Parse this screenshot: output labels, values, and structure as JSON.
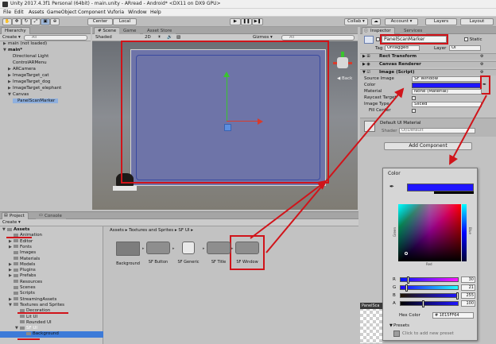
{
  "window": {
    "title": "Unity 2017.4.3f1 Personal (64bit) - main.unity - ARread - Android* <DX11 on DX9 GPU>"
  },
  "menu": [
    "File",
    "Edit",
    "Assets",
    "GameObject",
    "Component",
    "Vuforia",
    "Window",
    "Help"
  ],
  "toolbar": {
    "pivot": "Center",
    "space": "Local",
    "collab": "Collab ▾",
    "account": "Account ▾",
    "layers": "Layers",
    "layout": "Layout"
  },
  "hierarchy": {
    "tab": "Hierarchy",
    "create": "Create ▾",
    "search": "All",
    "items": [
      {
        "label": "main (not loaded)",
        "indent": 0,
        "arrow": "▶"
      },
      {
        "label": "main*",
        "indent": 0,
        "arrow": "▼"
      },
      {
        "label": "Directional Light",
        "indent": 1,
        "arrow": ""
      },
      {
        "label": "ControlARMenu",
        "indent": 1,
        "arrow": ""
      },
      {
        "label": "ARCamera",
        "indent": 1,
        "arrow": "▶"
      },
      {
        "label": "ImageTarget_cat",
        "indent": 1,
        "arrow": "▶"
      },
      {
        "label": "ImageTarget_dog",
        "indent": 1,
        "arrow": "▶"
      },
      {
        "label": "ImageTarget_elephant",
        "indent": 1,
        "arrow": "▶"
      },
      {
        "label": "Canvas",
        "indent": 1,
        "arrow": "▼"
      },
      {
        "label": "PanelScanMarker",
        "indent": 2,
        "arrow": ""
      }
    ]
  },
  "scene": {
    "tabs": [
      "# Scene",
      "Game",
      "Asset Store"
    ],
    "shading": "Shaded",
    "mode2d": "2D",
    "gizmos": "Gizmos ▾",
    "search": "All",
    "back": "◀ Back"
  },
  "inspector": {
    "tabs": [
      "Inspector",
      "Services"
    ],
    "object_name": "PanelScanMarker",
    "static": "Static",
    "tag_label": "Tag",
    "tag": "Untagged",
    "layer_label": "Layer",
    "layer": "UI",
    "components": [
      "Rect Transform",
      "Canvas Renderer",
      "Image (Script)"
    ],
    "fields": [
      {
        "label": "Source Image",
        "value": "SF Window"
      },
      {
        "label": "Color",
        "value": ""
      },
      {
        "label": "Material",
        "value": "None (Material)"
      },
      {
        "label": "Raycast Target",
        "value": ""
      },
      {
        "label": "Image Type",
        "value": "Sliced"
      },
      {
        "label": "Fill Center",
        "value": ""
      }
    ],
    "material_name": "Default UI Material",
    "shader_label": "Shader",
    "shader": "UI/Default",
    "add_component": "Add Component",
    "bottom_label": "PanelSca"
  },
  "color_picker": {
    "title": "Color",
    "side_label": "Blue",
    "left_label": "Green",
    "bottom_label": "Red",
    "current_color": "#1E15FF",
    "channels": [
      {
        "label": "R",
        "value": "30",
        "fraction": 0.12
      },
      {
        "label": "G",
        "value": "21",
        "fraction": 0.08
      },
      {
        "label": "B",
        "value": "255",
        "fraction": 1.0
      },
      {
        "label": "A",
        "value": "100",
        "fraction": 0.39
      }
    ],
    "hex_label": "Hex Color",
    "hex": "# 1E15FF64",
    "presets": "Presets",
    "add_preset": "Click to add new preset"
  },
  "project": {
    "tabs": [
      "Project",
      "Console"
    ],
    "create": "Create ▾",
    "tree": [
      {
        "label": "Assets",
        "indent": 0,
        "arrow": "▼",
        "bold": true
      },
      {
        "label": "Animation",
        "indent": 1,
        "arrow": ""
      },
      {
        "label": "Editor",
        "indent": 1,
        "arrow": "▶"
      },
      {
        "label": "Fonts",
        "indent": 1,
        "arrow": "▶"
      },
      {
        "label": "Images",
        "indent": 1,
        "arrow": ""
      },
      {
        "label": "Materials",
        "indent": 1,
        "arrow": ""
      },
      {
        "label": "Models",
        "indent": 1,
        "arrow": "▶"
      },
      {
        "label": "Plugins",
        "indent": 1,
        "arrow": "▶"
      },
      {
        "label": "Prefabs",
        "indent": 1,
        "arrow": "▶"
      },
      {
        "label": "Resources",
        "indent": 1,
        "arrow": ""
      },
      {
        "label": "Scenes",
        "indent": 1,
        "arrow": ""
      },
      {
        "label": "Scripts",
        "indent": 1,
        "arrow": ""
      },
      {
        "label": "StreamingAssets",
        "indent": 1,
        "arrow": "▶"
      },
      {
        "label": "Textures and Sprites",
        "indent": 1,
        "arrow": "▼"
      },
      {
        "label": "Decoration",
        "indent": 2,
        "arrow": ""
      },
      {
        "label": "Lit UI",
        "indent": 2,
        "arrow": ""
      },
      {
        "label": "Rounded UI",
        "indent": 2,
        "arrow": ""
      },
      {
        "label": "SF UI",
        "indent": 2,
        "arrow": "▼"
      },
      {
        "label": "Background",
        "indent": 3,
        "arrow": ""
      }
    ],
    "breadcrumb": "Assets ▸ Textures and Sprites ▸ SF UI ▸",
    "assets": [
      "Background",
      "SF Button",
      "SF Generic",
      "SF Title",
      "SF Window"
    ]
  },
  "colors": {
    "accent_red": "#d0141a",
    "selection": "#3d7bd8",
    "picked_color": "#1E15FF"
  }
}
